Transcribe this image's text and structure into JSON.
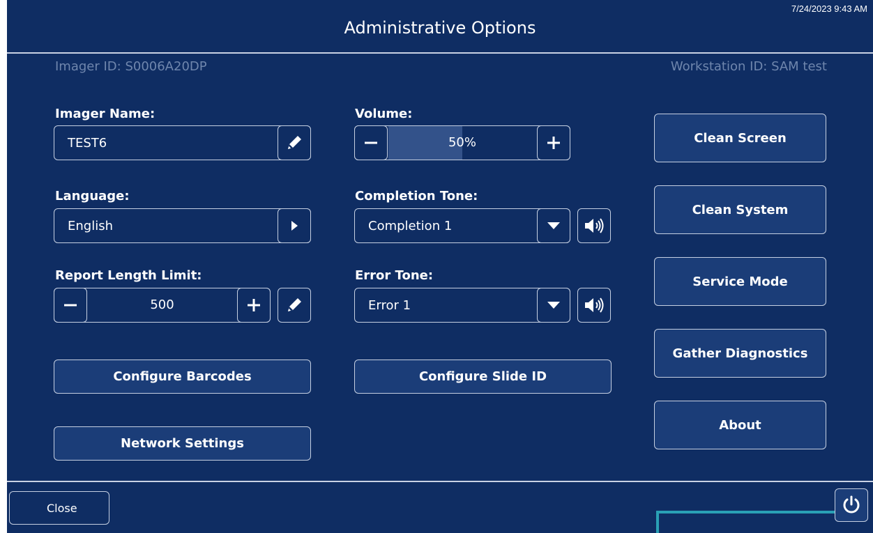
{
  "header": {
    "title": "Administrative Options",
    "timestamp": "7/24/2023 9:43 AM"
  },
  "ids": {
    "imager_id": "Imager ID: S0006A20DP",
    "workstation_id": "Workstation ID: SAM test"
  },
  "imager_name": {
    "label": "Imager Name:",
    "value": "TEST6"
  },
  "language": {
    "label": "Language:",
    "value": "English"
  },
  "report_length": {
    "label": "Report Length Limit:",
    "value": "500"
  },
  "volume": {
    "label": "Volume:",
    "value": "50%",
    "level_percent": 50
  },
  "completion_tone": {
    "label": "Completion Tone:",
    "value": "Completion 1"
  },
  "error_tone": {
    "label": "Error Tone:",
    "value": "Error 1"
  },
  "buttons": {
    "configure_barcodes": "Configure Barcodes",
    "configure_slide_id": "Configure Slide ID",
    "network_settings": "Network Settings",
    "clean_screen": "Clean Screen",
    "clean_system": "Clean System",
    "service_mode": "Service Mode",
    "gather_diagnostics": "Gather Diagnostics",
    "about": "About",
    "close": "Close"
  },
  "icons": {
    "edit": "pencil-icon",
    "forward": "chevron-right-icon",
    "dropdown": "caret-down-icon",
    "speaker": "speaker-icon",
    "minus": "minus-icon",
    "plus": "plus-icon",
    "power": "power-icon"
  },
  "colors": {
    "background": "#0f2d63",
    "button_fill": "#1b3d78",
    "border": "#c6d0e2",
    "muted_text": "#6f86ad",
    "accent_line": "#2aa0b5"
  }
}
